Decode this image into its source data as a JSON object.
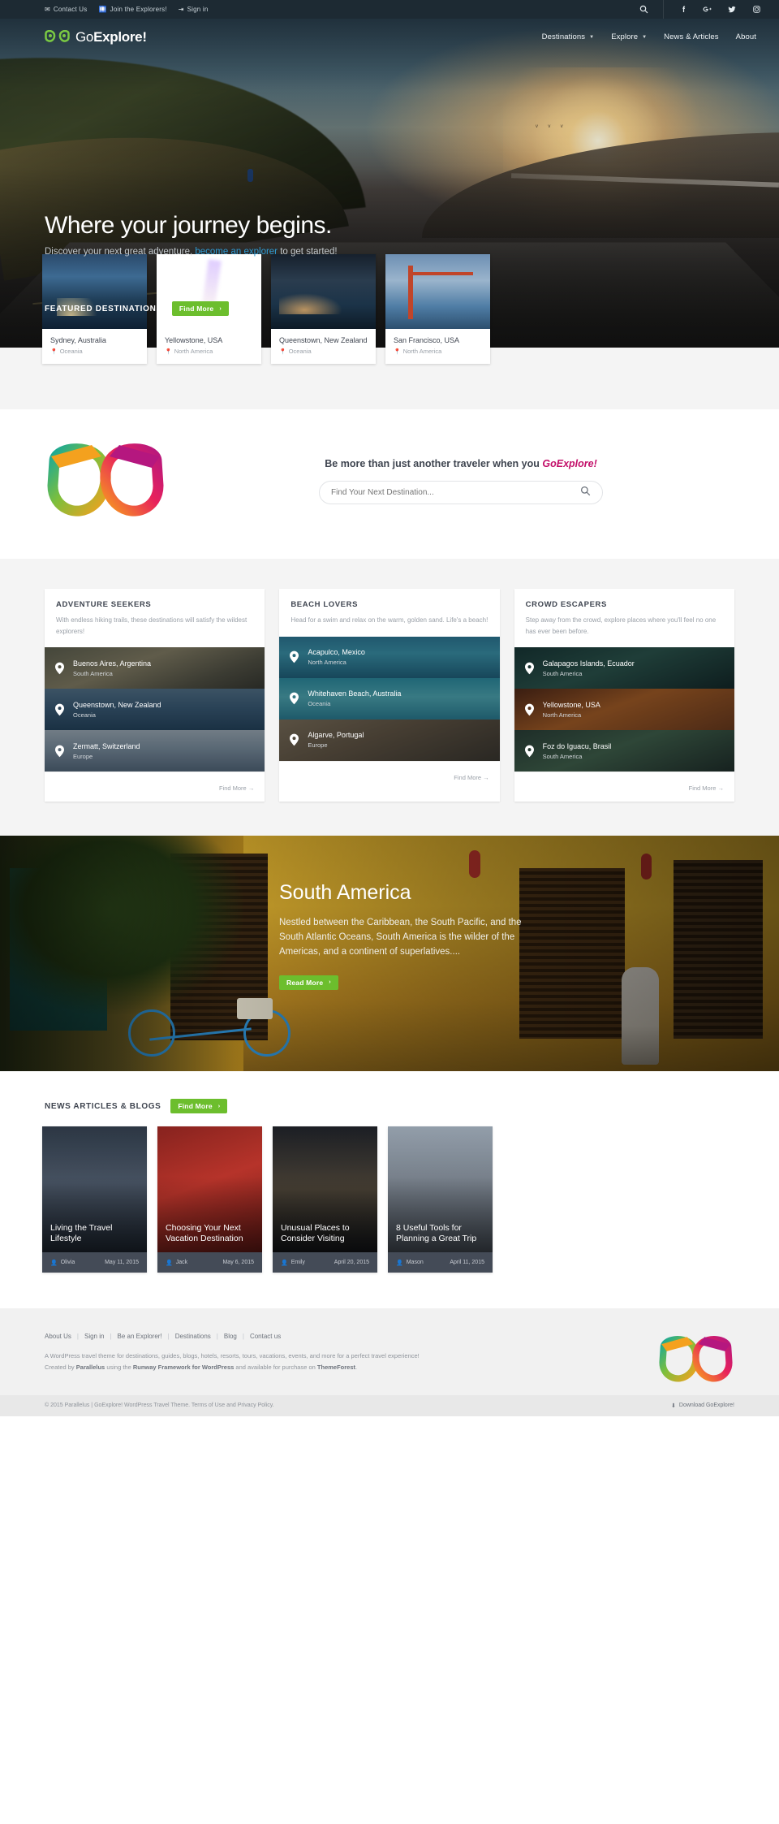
{
  "topbar": {
    "links": [
      {
        "icon": "envelope-icon",
        "label": "Contact Us"
      },
      {
        "icon": "suitcase-icon",
        "label": "Join the Explorers!"
      },
      {
        "icon": "signin-icon",
        "label": "Sign in"
      }
    ],
    "social": [
      "search-icon",
      "facebook-icon",
      "google-plus-icon",
      "twitter-icon",
      "instagram-icon"
    ]
  },
  "brand": {
    "name_light": "Go",
    "name_bold": "Explore!",
    "full": "GoExplore!"
  },
  "nav": {
    "items": [
      {
        "label": "Destinations",
        "has_dropdown": true
      },
      {
        "label": "Explore",
        "has_dropdown": true
      },
      {
        "label": "News & Articles",
        "has_dropdown": false
      },
      {
        "label": "About",
        "has_dropdown": false
      }
    ]
  },
  "hero": {
    "title": "Where your journey begins.",
    "sub_pre": "Discover your next great adventure, ",
    "sub_link": "become an explorer",
    "sub_post": " to get started!"
  },
  "featured": {
    "heading": "FEATURED DESTINATIONS",
    "button": "Find More",
    "button_arrow": "›",
    "cards": [
      {
        "name": "Sydney, Australia",
        "region": "Oceania",
        "img": "ph-sydney"
      },
      {
        "name": "Yellowstone, USA",
        "region": "North America",
        "img": "ph-yellow"
      },
      {
        "name": "Queenstown, New Zealand",
        "region": "Oceania",
        "img": "ph-queens"
      },
      {
        "name": "San Francisco, USA",
        "region": "North America",
        "img": "ph-sf"
      }
    ]
  },
  "search": {
    "tagline_pre": "Be more than just another traveler when you ",
    "tagline_brand": "GoExplore!",
    "placeholder": "Find Your Next Destination...",
    "value": "",
    "icon": "magnifier-icon"
  },
  "categories": [
    {
      "title": "ADVENTURE SEEKERS",
      "desc": "With endless hiking trails, these destinations will satisfy the wildest explorers!",
      "find_more": "Find More",
      "items": [
        {
          "name": "Buenos Aires, Argentina",
          "region": "South America",
          "img": "im-buenos"
        },
        {
          "name": "Queenstown, New Zealand",
          "region": "Oceania",
          "img": "im-queens2"
        },
        {
          "name": "Zermatt, Switzerland",
          "region": "Europe",
          "img": "im-zermatt"
        }
      ]
    },
    {
      "title": "BEACH LOVERS",
      "desc": "Head for a swim and relax on the warm, golden sand. Life's a beach!",
      "find_more": "Find More",
      "items": [
        {
          "name": "Acapulco, Mexico",
          "region": "North America",
          "img": "im-acapulco"
        },
        {
          "name": "Whitehaven Beach, Australia",
          "region": "Oceania",
          "img": "im-white"
        },
        {
          "name": "Algarve, Portugal",
          "region": "Europe",
          "img": "im-algarve"
        }
      ]
    },
    {
      "title": "CROWD ESCAPERS",
      "desc": "Step away from the crowd, explore places where you'll feel no one has ever been before.",
      "find_more": "Find More",
      "items": [
        {
          "name": "Galapagos Islands, Ecuador",
          "region": "South America",
          "img": "im-galap"
        },
        {
          "name": "Yellowstone, USA",
          "region": "North America",
          "img": "im-yellow2"
        },
        {
          "name": "Foz do Iguacu, Brasil",
          "region": "South America",
          "img": "im-foz"
        }
      ]
    }
  ],
  "region_banner": {
    "title": "South America",
    "text": "Nestled between the Caribbean, the South Pacific, and the South Atlantic Oceans, South America is the wilder of the Americas, and a continent of superlatives....",
    "button": "Read More",
    "button_arrow": "›"
  },
  "news": {
    "heading": "NEWS ARTICLES & BLOGS",
    "button": "Find More",
    "button_arrow": "›",
    "cards": [
      {
        "title": "Living the Travel Lifestyle",
        "author": "Olivia",
        "date": "May 11, 2015",
        "img": "im-bridge"
      },
      {
        "title": "Choosing Your Next Vacation Destination",
        "author": "Jack",
        "date": "May 6, 2015",
        "img": "im-vac"
      },
      {
        "title": "Unusual Places to Consider Visiting",
        "author": "Emily",
        "date": "April 20, 2015",
        "img": "im-rail"
      },
      {
        "title": "8 Useful Tools for Planning a Great Trip",
        "author": "Mason",
        "date": "April 11, 2015",
        "img": "im-city"
      }
    ]
  },
  "footer": {
    "links": [
      "About Us",
      "Sign in",
      "Be an Explorer!",
      "Destinations",
      "Blog",
      "Contact us"
    ],
    "separator": "|",
    "desc_line1": "A WordPress travel theme for destinations, guides, blogs, hotels, resorts, tours, vacations, events, and more for a perfect travel experience!",
    "desc_line2_pre": "Created by ",
    "desc_line2_b1": "Parallelus",
    "desc_line2_mid": " using the ",
    "desc_line2_b2": "Runway Framework for WordPress",
    "desc_line2_mid2": " and available for purchase on ",
    "desc_line2_b3": "ThemeForest",
    "desc_line2_end": ".",
    "copyright": "© 2015 Parallelus | GoExplore! WordPress Travel Theme. Terms of Use and Privacy Policy.",
    "download": "Download GoExplore!",
    "download_icon": "download-icon"
  },
  "colors": {
    "green": "#6cbe2d",
    "link_blue": "#2e9bd4",
    "brand_pink": "#c3106a",
    "topbar_dark": "#1d2a33",
    "meta_slate": "#444b57"
  }
}
